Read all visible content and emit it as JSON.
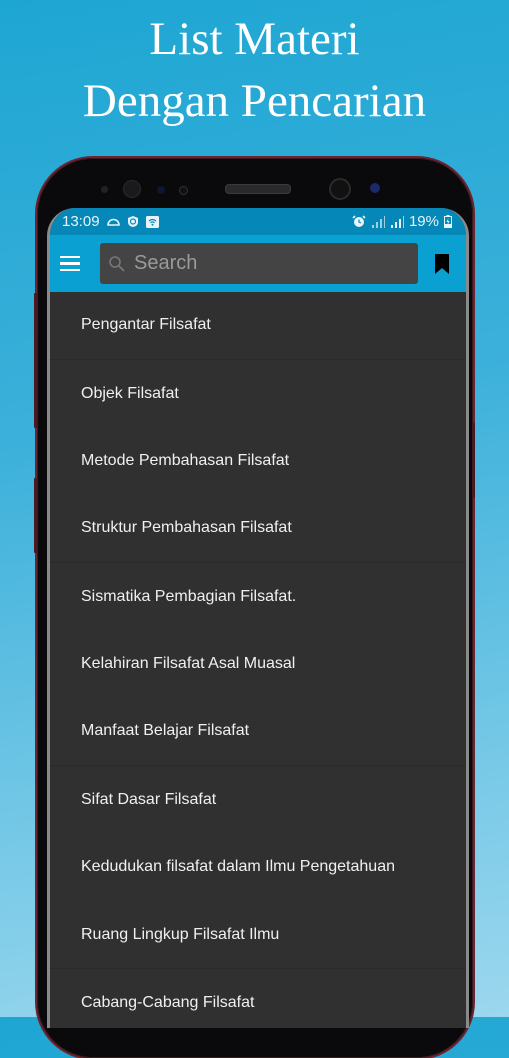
{
  "promo": {
    "title_line1": "List Materi",
    "title_line2": "Dengan Pencarian"
  },
  "statusbar": {
    "time": "13:09",
    "left_icons": [
      "cloud-icon",
      "shield-icon",
      "wifi-icon"
    ],
    "right_icons": [
      "alarm-icon",
      "signal-icon",
      "signal-icon"
    ],
    "battery": "19%"
  },
  "appbar": {
    "menu_icon": "hamburger-menu-icon",
    "search_placeholder": "Search",
    "search_value": "",
    "bookmark_icon": "bookmark-icon",
    "color": "#0ba0d2"
  },
  "list": {
    "items": [
      {
        "label": "Pengantar Filsafat"
      },
      {
        "label": "Objek Filsafat"
      },
      {
        "label": "Metode Pembahasan Filsafat"
      },
      {
        "label": "Struktur Pembahasan Filsafat"
      },
      {
        "label": "Sismatika Pembagian Filsafat."
      },
      {
        "label": "Kelahiran Filsafat Asal Muasal"
      },
      {
        "label": "Manfaat Belajar Filsafat"
      },
      {
        "label": "Sifat Dasar Filsafat"
      },
      {
        "label": "Kedudukan filsafat dalam Ilmu Pengetahuan"
      },
      {
        "label": "Ruang Lingkup Filsafat Ilmu"
      },
      {
        "label": "Cabang-Cabang Filsafat"
      }
    ]
  }
}
